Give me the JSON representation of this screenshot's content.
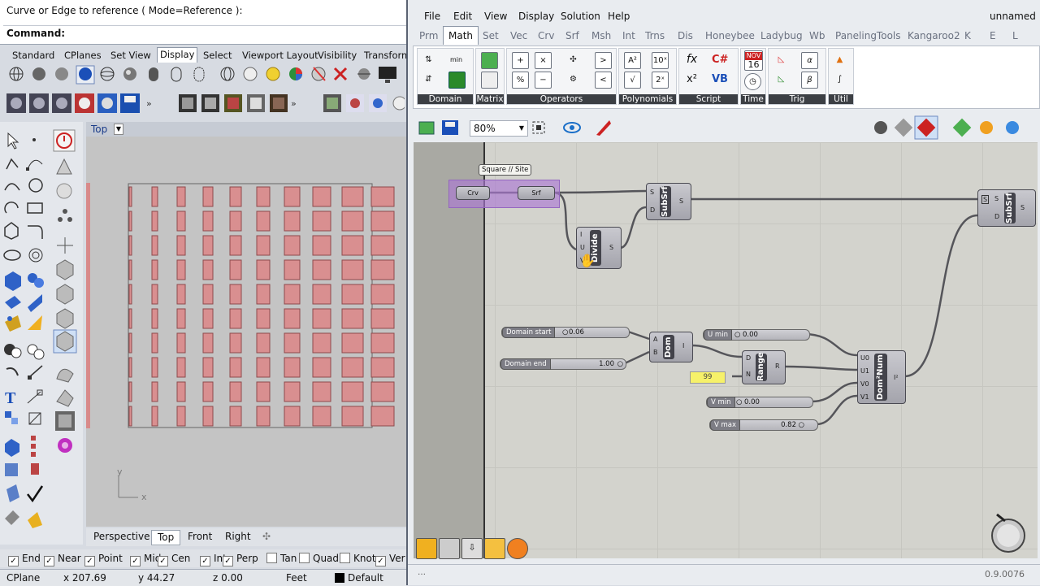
{
  "rhino": {
    "command_history": "Curve or Edge to reference ( Mode=Reference ):",
    "command_label": "Command:",
    "toolbar_tabs": [
      "Standard",
      "CPlanes",
      "Set View",
      "Display",
      "Select",
      "Viewport Layout",
      "Visibility",
      "Transform"
    ],
    "active_toolbar_tab": "Display",
    "viewport_title": "Top",
    "viewport_tabs": [
      "Perspective",
      "Top",
      "Front",
      "Right"
    ],
    "active_viewport_tab": "Top",
    "add_viewport_symbol": "✣",
    "axis_y": "y",
    "axis_x": "x",
    "osnaps": [
      {
        "label": "End",
        "checked": true
      },
      {
        "label": "Near",
        "checked": true
      },
      {
        "label": "Point",
        "checked": true
      },
      {
        "label": "Mid",
        "checked": true
      },
      {
        "label": "Cen",
        "checked": true
      },
      {
        "label": "Int",
        "checked": true
      },
      {
        "label": "Perp",
        "checked": true
      },
      {
        "label": "Tan",
        "checked": false
      },
      {
        "label": "Quad",
        "checked": false
      },
      {
        "label": "Knot",
        "checked": false
      },
      {
        "label": "Ver",
        "checked": true
      }
    ],
    "status": {
      "cplane": "CPlane",
      "x": "x 207.69",
      "y": "y 44.27",
      "z": "z 0.00",
      "units": "Feet",
      "layer": "Default"
    }
  },
  "grasshopper": {
    "title": "unnamed",
    "menu": [
      "File",
      "Edit",
      "View",
      "Display",
      "Solution",
      "Help"
    ],
    "tabs": [
      "Prm",
      "Math",
      "Set",
      "Vec",
      "Crv",
      "Srf",
      "Msh",
      "Int",
      "Trns",
      "Dis",
      "Honeybee",
      "Ladybug",
      "Wb",
      "PanelingTools",
      "Kangaroo2",
      "K",
      "E",
      "L"
    ],
    "active_tab": "Math",
    "ribbon_groups": [
      "Domain",
      "Matrix",
      "Operators",
      "Polynomials",
      "Script",
      "Time",
      "Trig",
      "Util"
    ],
    "ribbon_glyphs": {
      "plus": "+",
      "times": "×",
      "divide": "%",
      "minus": "−",
      "greater": ">",
      "less": "<",
      "pow_a2": "A²",
      "pow_10": "10ˣ",
      "sqrt": "√",
      "pow_2x": "2ˣ",
      "fx": "fx",
      "x2": "x²",
      "csharp": "C#",
      "vb": "VB",
      "cal_month": "NOV",
      "cal_day": "16",
      "alpha": "α",
      "beta": "β"
    },
    "zoom": "80%",
    "canvas": {
      "group_label": "Square // Site",
      "crv": "Crv",
      "srf": "Srf",
      "subsrf": "SubSrf",
      "divide": "Divide",
      "dom": "Dom",
      "range": "Range",
      "domnum": "Dom²Num",
      "panel_value": "99",
      "sliders": [
        {
          "name": "Domain start",
          "value": "0.06"
        },
        {
          "name": "Domain end",
          "value": "1.00"
        },
        {
          "name": "U min",
          "value": "0.00"
        },
        {
          "name": "V min",
          "value": "0.00"
        },
        {
          "name": "V max",
          "value": "0.82"
        }
      ],
      "pins": {
        "S": "S",
        "D": "D",
        "I": "I",
        "U": "U",
        "V": "V",
        "A": "A",
        "B": "B",
        "N": "N",
        "R": "R",
        "U0": "U0",
        "U1": "U1",
        "V0": "V0",
        "V1": "V1",
        "I2": "I²"
      }
    },
    "version": "0.9.0076",
    "status_left": "…"
  }
}
